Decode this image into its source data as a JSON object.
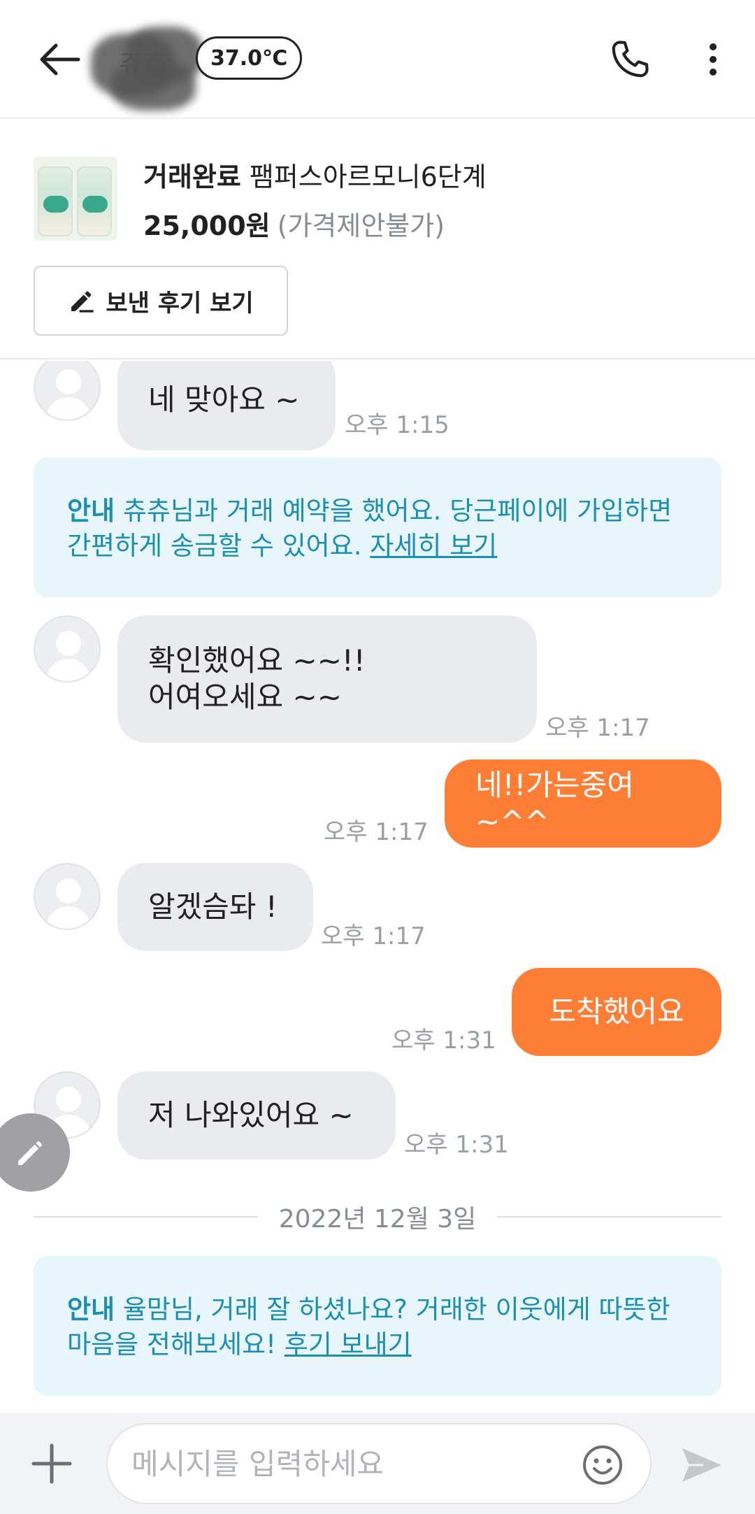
{
  "header": {
    "nickname": "츄츄",
    "manner_temp": "37.0℃"
  },
  "product": {
    "status": "거래완료",
    "title": "팸퍼스아르모니6단계",
    "price": "25,000원",
    "price_note": "(가격제안불가)",
    "review_button_label": "보낸 후기 보기"
  },
  "messages": [
    {
      "text": "네 맞아요 ~",
      "time": "오후 1:15"
    },
    {
      "text": "확인했어요 ~~!!\n어여오세요 ~~",
      "time": "오후 1:17"
    },
    {
      "text": "네!!가는중여~^^",
      "time": "오후 1:17"
    },
    {
      "text": "알겠슴돠 !",
      "time": "오후 1:17"
    },
    {
      "text": "도착했어요",
      "time": "오후 1:31"
    },
    {
      "text": "저 나와있어요 ~",
      "time": "오후 1:31"
    }
  ],
  "notices": [
    {
      "tag": "안내",
      "text": "츄츄님과 거래 예약을 했어요. 당근페이에 가입하면 간편하게 송금할 수 있어요.",
      "link": "자세히 보기"
    },
    {
      "tag": "안내",
      "text": "율맘님, 거래 잘 하셨나요? 거래한 이웃에게 따뜻한 마음을 전해보세요!",
      "link": "후기 보내기"
    }
  ],
  "date_divider": "2022년 12월 3일",
  "input": {
    "placeholder": "메시지를 입력하세요"
  },
  "colors": {
    "accent_orange": "#ff7e36",
    "notice_blue": "#1a8fb3",
    "notice_bg": "#e8f6fb"
  }
}
